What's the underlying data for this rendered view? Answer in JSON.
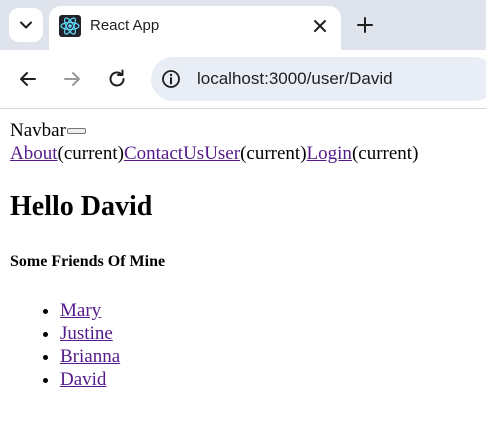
{
  "browser": {
    "tab": {
      "title": "React App",
      "favicon": "react-logo-icon"
    },
    "address_bar": {
      "url": "localhost:3000/user/David"
    },
    "icons": {
      "tab_search": "chevron-down-icon",
      "close": "close-icon",
      "new_tab": "plus-icon",
      "back": "arrow-left-icon",
      "forward": "arrow-right-icon",
      "reload": "reload-icon",
      "site_info": "info-icon"
    }
  },
  "navbar": {
    "brand": "Navbar",
    "links": [
      {
        "label": "About",
        "suffix": "(current)"
      },
      {
        "label": "ContactUs",
        "suffix": ""
      },
      {
        "label": "User",
        "suffix": "(current)"
      },
      {
        "label": "Login",
        "suffix": "(current)"
      }
    ]
  },
  "main": {
    "heading": "Hello David",
    "subheading": "Some Friends Of Mine",
    "friends": [
      "Mary",
      "Justine",
      "Brianna",
      "David"
    ]
  },
  "colors": {
    "link": "#551a8b",
    "tabstrip": "#dfe3eb",
    "omnibox": "#e9edf5"
  }
}
